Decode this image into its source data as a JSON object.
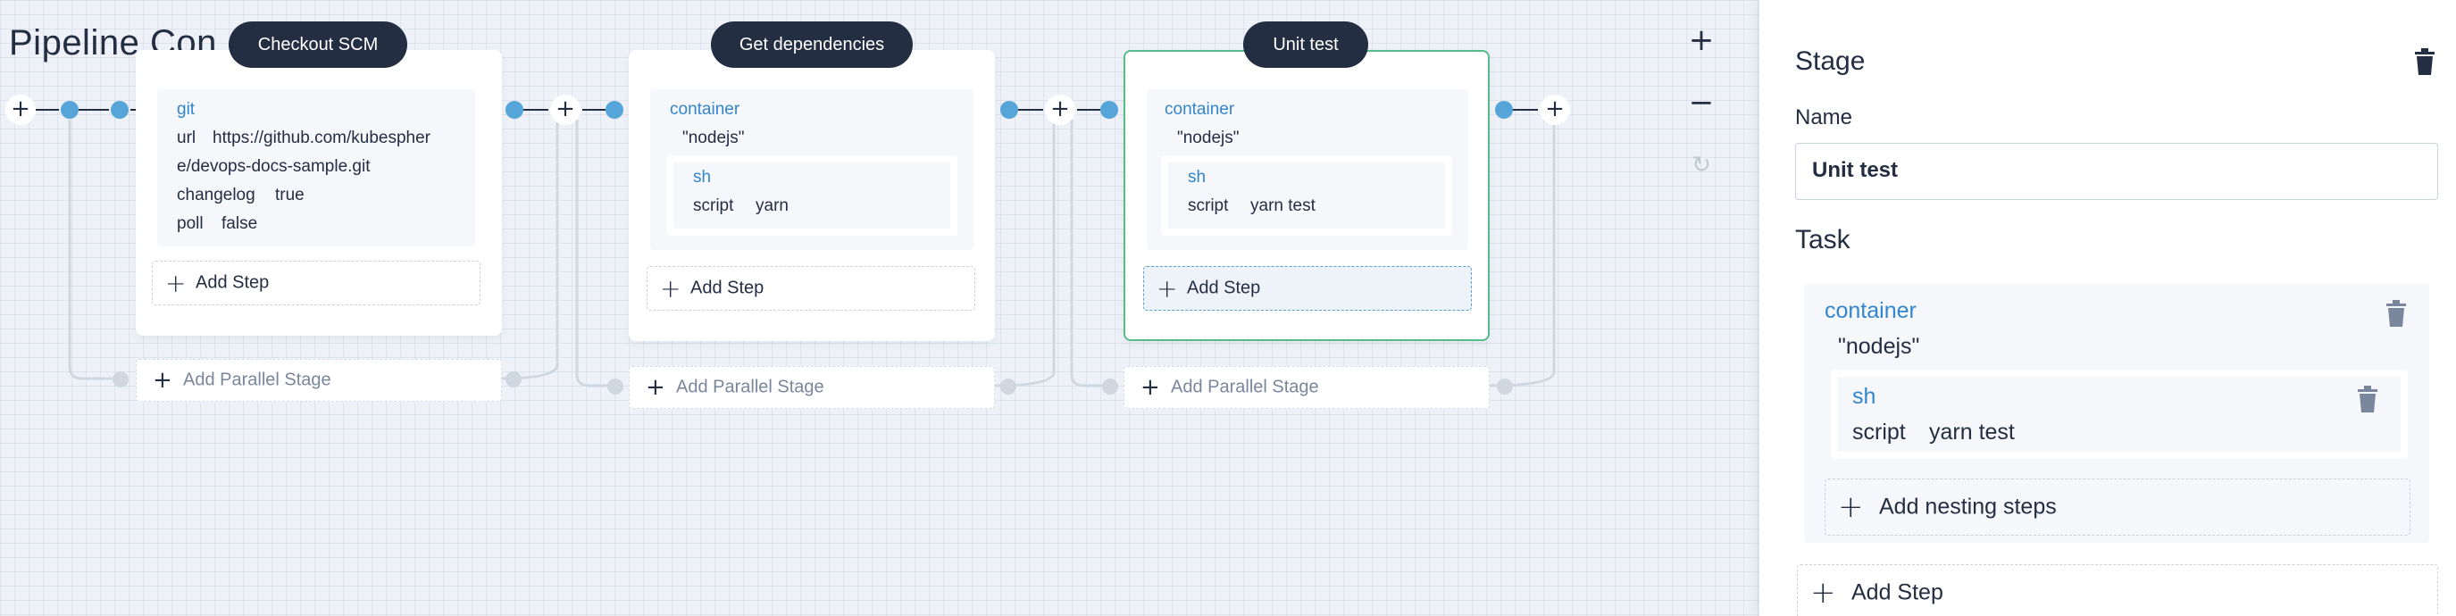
{
  "page": {
    "title": "Pipeline Con"
  },
  "stages": [
    {
      "name": "Checkout SCM",
      "steps": {
        "kind": "git",
        "lines": [
          {
            "key": "url",
            "value": "https://github.com/kubespher"
          },
          {
            "key": "",
            "value": "e/devops-docs-sample.git"
          },
          {
            "key": "changelog",
            "value": "true"
          },
          {
            "key": "poll",
            "value": "false"
          }
        ]
      },
      "add_step": "Add Step",
      "add_parallel": "Add Parallel Stage"
    },
    {
      "name": "Get dependencies",
      "container": {
        "kind": "container",
        "arg": "\"nodejs\""
      },
      "nested": {
        "kind": "sh",
        "key": "script",
        "value": "yarn"
      },
      "add_step": "Add Step",
      "add_parallel": "Add Parallel Stage"
    },
    {
      "name": "Unit test",
      "container": {
        "kind": "container",
        "arg": "\"nodejs\""
      },
      "nested": {
        "kind": "sh",
        "key": "script",
        "value": "yarn test"
      },
      "add_step": "Add Step",
      "add_parallel": "Add Parallel Stage"
    }
  ],
  "zoom": {
    "zoom_in": "+",
    "zoom_out": "−",
    "reset": "↻"
  },
  "panel": {
    "heading": "Stage",
    "name_label": "Name",
    "name_value": "Unit test",
    "task_heading": "Task",
    "task": {
      "container_kind": "container",
      "container_arg": "\"nodejs\"",
      "nested_kind": "sh",
      "nested_key": "script",
      "nested_value": "yarn test",
      "add_nesting": "Add nesting steps"
    },
    "add_step": "Add Step"
  },
  "colors": {
    "accent_blue": "#55a5d8",
    "keyword_blue": "#3385cc",
    "active_green": "#55bc8a",
    "dark": "#242e42"
  }
}
